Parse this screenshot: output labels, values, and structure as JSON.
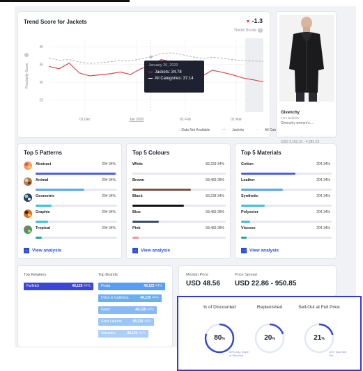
{
  "trend": {
    "title": "Trend Score for Jackets",
    "delta": "-1.3",
    "score_label": "Trend Score",
    "y_axis_label": "Popularity Score",
    "legend": {
      "na": "Data Not Available",
      "jackets": "Jackets",
      "all": "All Categories"
    },
    "tooltip": {
      "date": "January 20, 2020",
      "jackets": "Jackets: 34.78",
      "all": "All Categories: 37.14"
    }
  },
  "chart_data": {
    "type": "line",
    "ylabel": "Popularity Score",
    "ylim": [
      22,
      42
    ],
    "y_ticks": [
      40,
      35,
      30,
      25
    ],
    "x_tick_labels": [
      "01 Dec",
      "Jan 2020",
      "01 Feb",
      "01 Mar"
    ],
    "series": [
      {
        "name": "Jackets",
        "color": "#d84a4a",
        "values": [
          34.5,
          33.8,
          35.4,
          32.6,
          31.8,
          32.1,
          32.4,
          32.9,
          32.2,
          33.8,
          34.78,
          36.4,
          35.8,
          33.3,
          32.5,
          31.7,
          33.4,
          32.8,
          32.1,
          31.2,
          30.7,
          30.1
        ]
      },
      {
        "name": "All Categories",
        "color": "#a8a8a8",
        "values": [
          36.8,
          36.2,
          36.4,
          35.7,
          35.3,
          35.5,
          35.8,
          36.1,
          36.0,
          36.6,
          37.14,
          38.1,
          38.3,
          37.8,
          37.2,
          36.7,
          37.0,
          36.8,
          36.4,
          36.1,
          36.0,
          35.9
        ]
      }
    ]
  },
  "product": {
    "brand": "Givenchy",
    "sub": "Fom Bubblior",
    "desc": "Givenchy women's...",
    "price": "USD 3,162.31 - 4,381.23"
  },
  "patterns": {
    "title": "Top 5 Patterns",
    "link": "View analysis",
    "items": [
      {
        "label": "Abstract",
        "value": "204 34%",
        "pct": 0.98,
        "color": "#4c5fe0"
      },
      {
        "label": "Animal",
        "value": "204 34%",
        "pct": 0.6,
        "color": "#5aa6ee"
      },
      {
        "label": "Geometric",
        "value": "204 34%",
        "pct": 0.2,
        "color": "#3cc0d6"
      },
      {
        "label": "Graphic",
        "value": "204 34%",
        "pct": 0.15,
        "color": "#3cc0d6"
      },
      {
        "label": "Tropical",
        "value": "204 34%",
        "pct": 0.08,
        "color": "#27a59a"
      }
    ]
  },
  "colours": {
    "title": "Top 5 Colours",
    "link": "View analysis",
    "items": [
      {
        "label": "White",
        "value": "83,239 34%",
        "pct": 0.0,
        "color": "#ffffff"
      },
      {
        "label": "Brown",
        "value": "58,483 28%",
        "pct": 0.63,
        "color": "#7a5344"
      },
      {
        "label": "Black",
        "value": "83,238 34%",
        "pct": 0.55,
        "color": "#111111"
      },
      {
        "label": "Blue",
        "value": "58,483 28%",
        "pct": 0.28,
        "color": "#3b4a6b"
      },
      {
        "label": "Pink",
        "value": "58,483 28%",
        "pct": 0.07,
        "color": "#e89a93"
      }
    ]
  },
  "materials": {
    "title": "Top 5 Materials",
    "link": "View analysis",
    "items": [
      {
        "label": "Cotton",
        "value": "204 34%",
        "pct": 0.6,
        "color": "#4c5fe0"
      },
      {
        "label": "Leather",
        "value": "204 34%",
        "pct": 0.46,
        "color": "#5aa6ee"
      },
      {
        "label": "Synthetic",
        "value": "204 34%",
        "pct": 0.26,
        "color": "#3cc0d6"
      },
      {
        "label": "Polyester",
        "value": "204 34%",
        "pct": 0.1,
        "color": "#3cc0d6"
      },
      {
        "label": "Viscose",
        "value": "204 34%",
        "pct": 0.06,
        "color": "#27a59a"
      }
    ]
  },
  "retailers": {
    "label": "Top Retailers",
    "items": [
      {
        "name": "Farfetch",
        "value": "48,125",
        "pct": "44%"
      }
    ]
  },
  "brands": {
    "label": "Top Brands",
    "items": [
      {
        "name": "Prada",
        "value": "48,125",
        "pct": "44%"
      },
      {
        "name": "Dolce & Gabbana",
        "value": "48,125",
        "pct": "44%"
      },
      {
        "name": "Gucci",
        "value": "48,125",
        "pct": "44%"
      },
      {
        "name": "Saint Laurent",
        "value": "48,125",
        "pct": "44%"
      },
      {
        "name": "Valentino",
        "value": "48,125",
        "pct": "44%"
      }
    ]
  },
  "price": {
    "median_label": "Median Price",
    "median_value": "USD 48.56",
    "spread_label": "Price Spread",
    "spread_value": "USD 22.86 - 950.85"
  },
  "overlay": {
    "items": [
      {
        "title": "% of Discounted",
        "value": "80",
        "unit": "%",
        "pct": 0.8,
        "note": "20% Avg. Depth of Discount"
      },
      {
        "title": "Replenished",
        "value": "20",
        "unit": "%",
        "pct": 0.2,
        "note": ""
      },
      {
        "title": "Sell-Out at Full Price",
        "value": "21",
        "unit": "%",
        "pct": 0.21,
        "note": "20% Total Sell Out"
      }
    ]
  }
}
